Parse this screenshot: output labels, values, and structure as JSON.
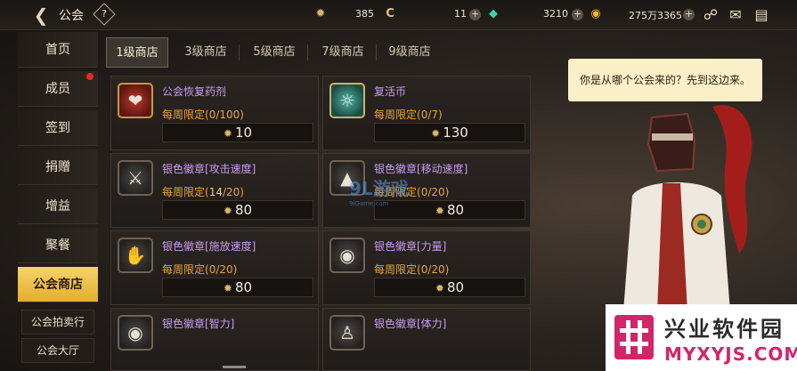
{
  "topbar": {
    "title": "公会",
    "help_label": "?",
    "resources": [
      {
        "name": "guild-coin",
        "value": "385"
      },
      {
        "name": "currency-c",
        "value": "11"
      },
      {
        "name": "gem",
        "value": "3210"
      },
      {
        "name": "gold",
        "value": "275万3365"
      }
    ]
  },
  "sidebar": {
    "items": [
      {
        "label": "首页"
      },
      {
        "label": "成员"
      },
      {
        "label": "签到"
      },
      {
        "label": "捐赠"
      },
      {
        "label": "增益"
      },
      {
        "label": "聚餐"
      },
      {
        "label": "公会商店"
      }
    ],
    "active_index": 6,
    "sub_items": [
      {
        "label": "公会拍卖行"
      },
      {
        "label": "公会大厅"
      }
    ]
  },
  "tabs": [
    {
      "label": "1级商店"
    },
    {
      "label": "3级商店"
    },
    {
      "label": "5级商店"
    },
    {
      "label": "7级商店"
    },
    {
      "label": "9级商店"
    }
  ],
  "shop": {
    "limit_label": "每周限定",
    "items": [
      {
        "name": "公会恢复药剂",
        "limit": "(0/100)",
        "limit_count": "",
        "price": "10",
        "icon": "potion-icon"
      },
      {
        "name": "复活币",
        "limit": "(0/7)",
        "limit_count": "",
        "price": "130",
        "icon": "revive-coin-icon"
      },
      {
        "name": "银色徽章[攻击速度]",
        "limit_pre": "(",
        "limit_count": "14",
        "limit_post": "/20)",
        "price": "80",
        "icon": "sword-badge-icon"
      },
      {
        "name": "银色徽章[移动速度]",
        "limit": "(0/20)",
        "price": "80",
        "icon": "boot-badge-icon"
      },
      {
        "name": "银色徽章[施放速度]",
        "limit": "(0/20)",
        "price": "80",
        "icon": "hand-badge-icon"
      },
      {
        "name": "银色徽章[力量]",
        "limit": "(0/20)",
        "price": "80",
        "icon": "fist-badge-icon"
      },
      {
        "name": "银色徽章[智力]",
        "limit": "",
        "price": "",
        "icon": "eye-badge-icon"
      },
      {
        "name": "银色徽章[体力]",
        "limit": "",
        "price": "",
        "icon": "body-badge-icon"
      }
    ]
  },
  "npc": {
    "speech": "你是从哪个公会来的？先到这边来。"
  },
  "watermark": {
    "center_text": "9L游戏",
    "center_sub": "9lGame.com",
    "brand_name": "兴业软件园",
    "brand_url": "MYXYJS.COM"
  },
  "colors": {
    "accent_gold": "#e4ad2e",
    "item_name_purple": "#c99bf2",
    "limit_orange": "#e8a43a",
    "bubble_bg": "#fbefc7",
    "alert_red": "#e02e1f"
  }
}
